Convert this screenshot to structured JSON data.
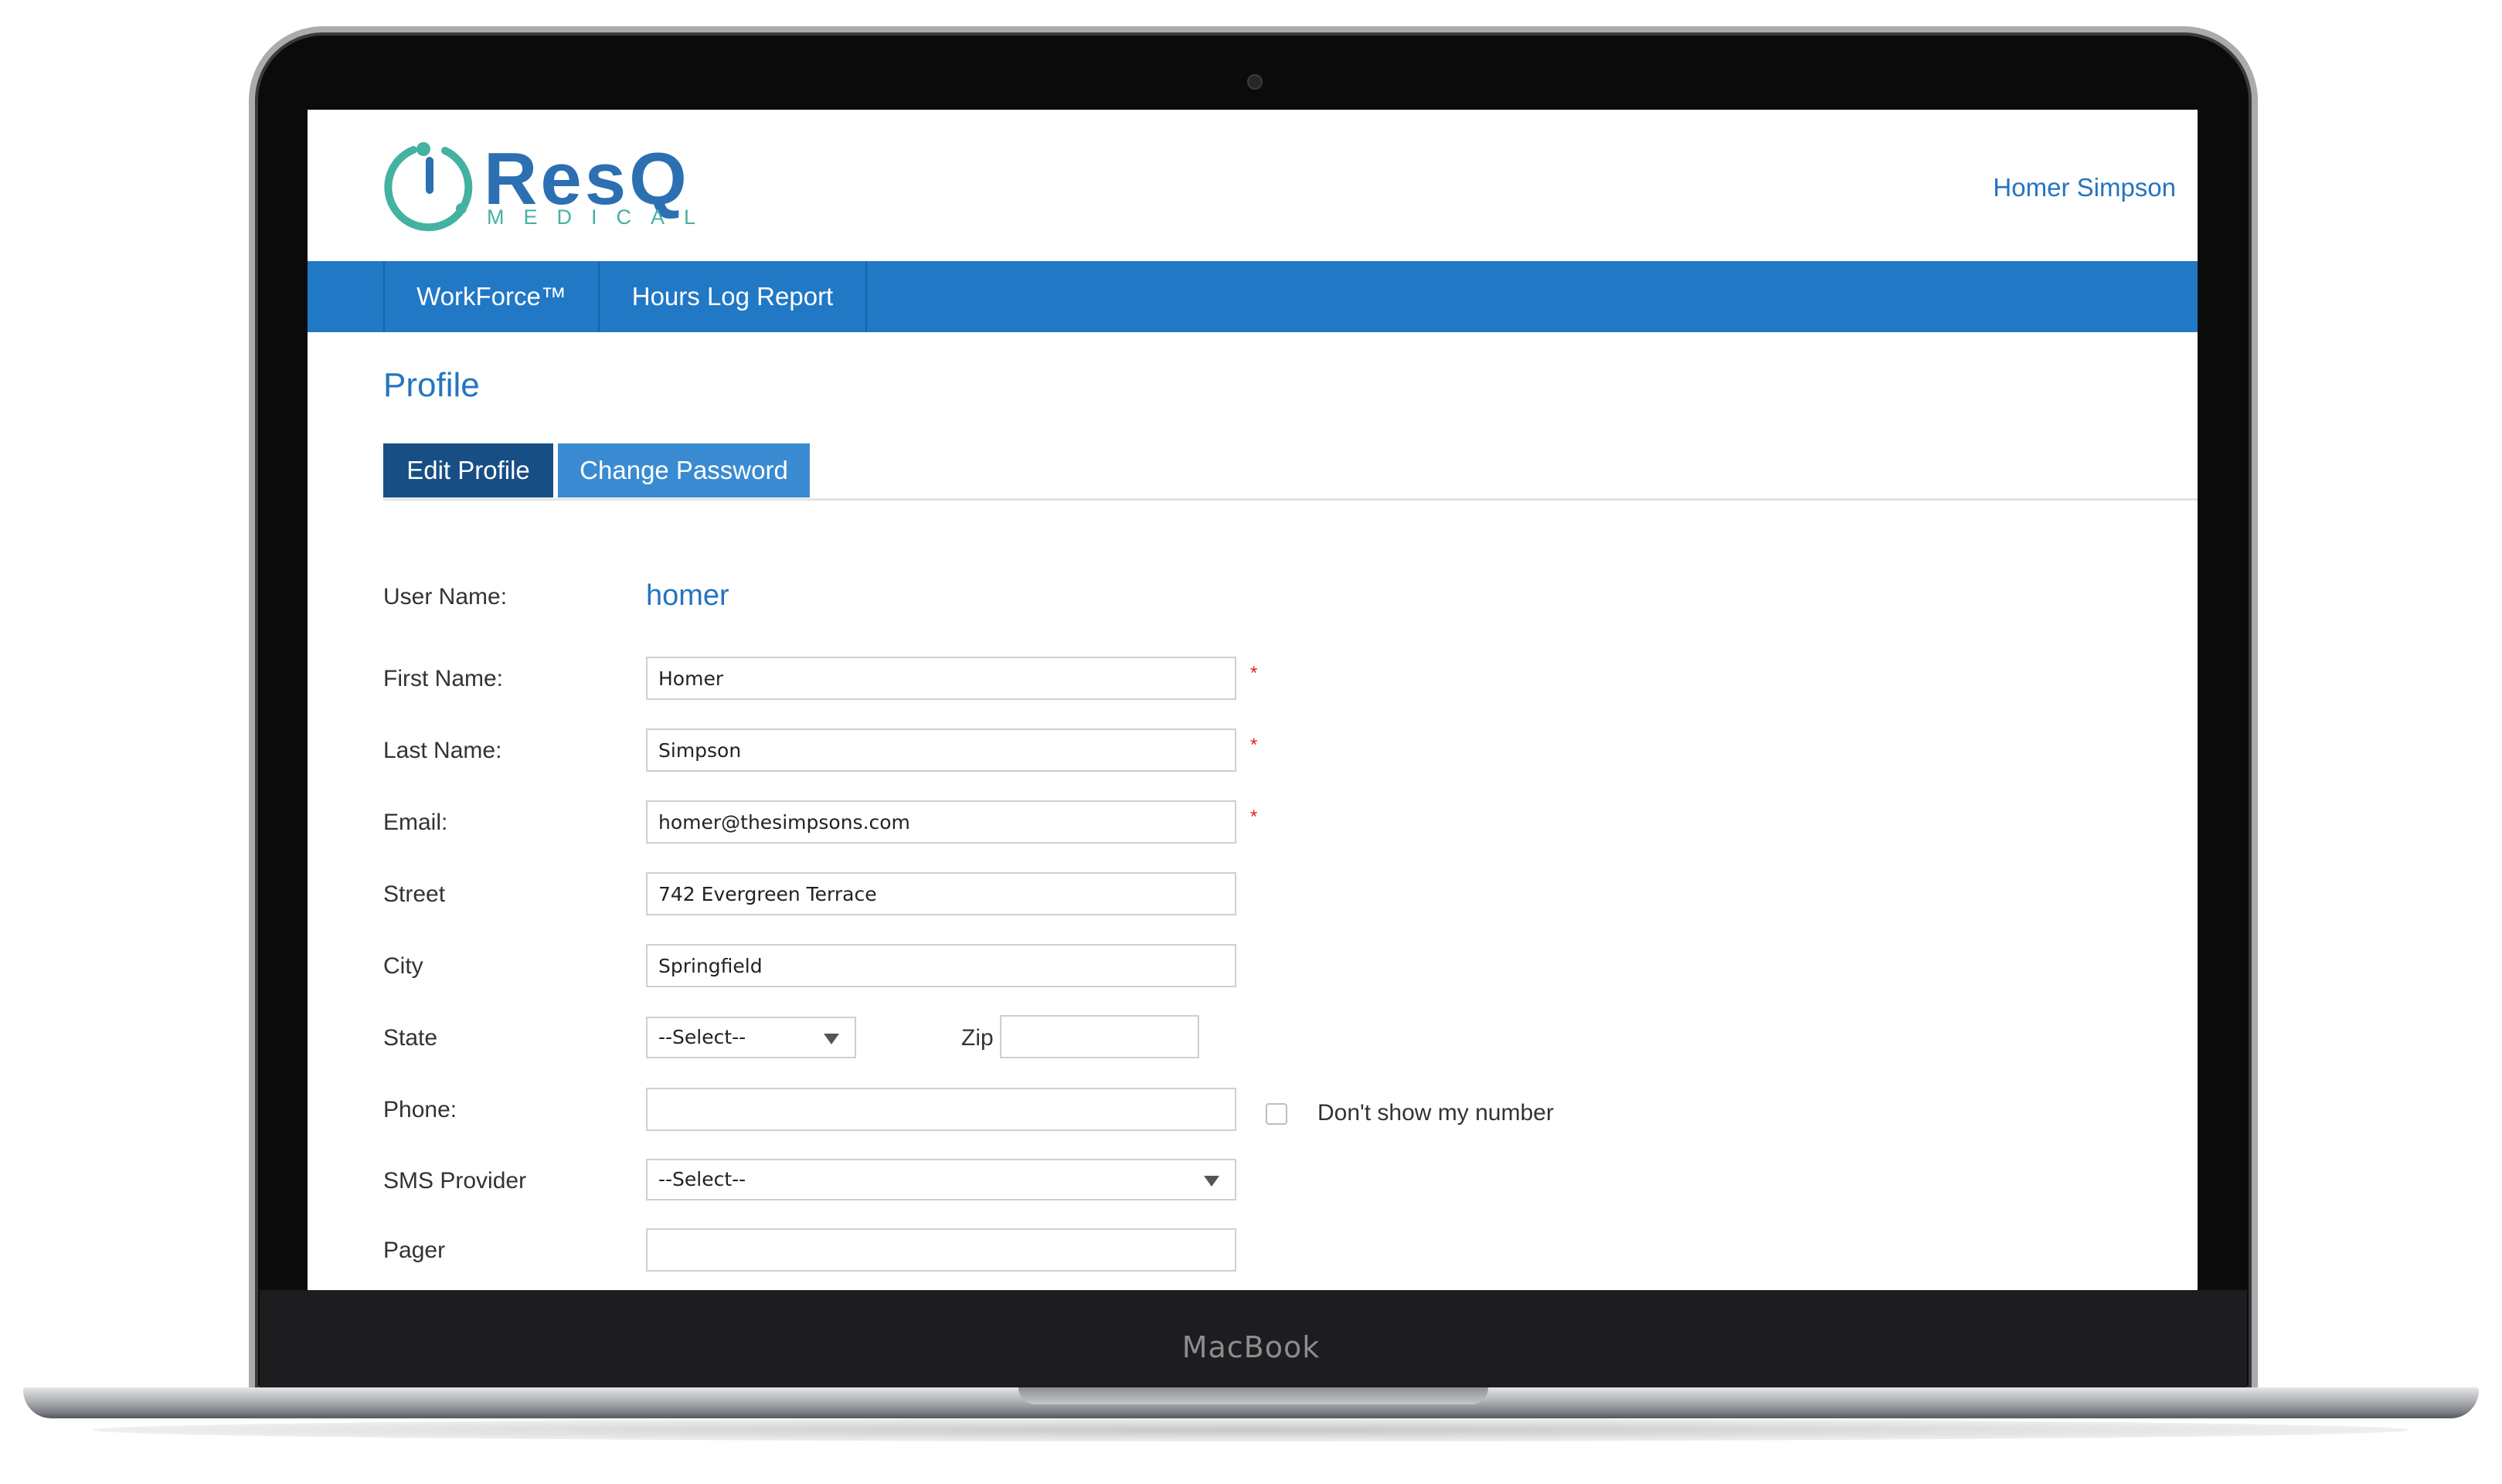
{
  "device": {
    "brand_label": "MacBook"
  },
  "header": {
    "logo_word": "ResQ",
    "logo_sub": "MEDICAL",
    "user_name": "Homer Simpson"
  },
  "nav": {
    "items": [
      {
        "label": "WorkForce™"
      },
      {
        "label": "Hours Log Report"
      }
    ]
  },
  "page": {
    "title": "Profile",
    "tabs": [
      {
        "label": "Edit Profile",
        "active": true
      },
      {
        "label": "Change Password",
        "active": false
      }
    ]
  },
  "form": {
    "username": {
      "label": "User Name:",
      "value": "homer"
    },
    "first_name": {
      "label": "First Name:",
      "value": "Homer",
      "required": "*"
    },
    "last_name": {
      "label": "Last Name:",
      "value": "Simpson",
      "required": "*"
    },
    "email": {
      "label": "Email:",
      "value": "homer@thesimpsons.com",
      "required": "*"
    },
    "street": {
      "label": "Street",
      "value": "742 Evergreen Terrace"
    },
    "city": {
      "label": "City",
      "value": "Springfield"
    },
    "state": {
      "label": "State",
      "value": "--Select--"
    },
    "zip": {
      "label": "Zip",
      "value": ""
    },
    "phone": {
      "label": "Phone:",
      "value": "",
      "hide_label": "Don't show my number"
    },
    "sms_provider": {
      "label": "SMS Provider",
      "value": "--Select--"
    },
    "pager": {
      "label": "Pager",
      "value": ""
    }
  },
  "colors": {
    "brand_blue": "#2178c5",
    "link_blue": "#2574c1",
    "tab_active": "#174f84",
    "tab_inactive": "#3a8bd1",
    "logo_teal": "#43b2a0",
    "required": "#e02424"
  }
}
